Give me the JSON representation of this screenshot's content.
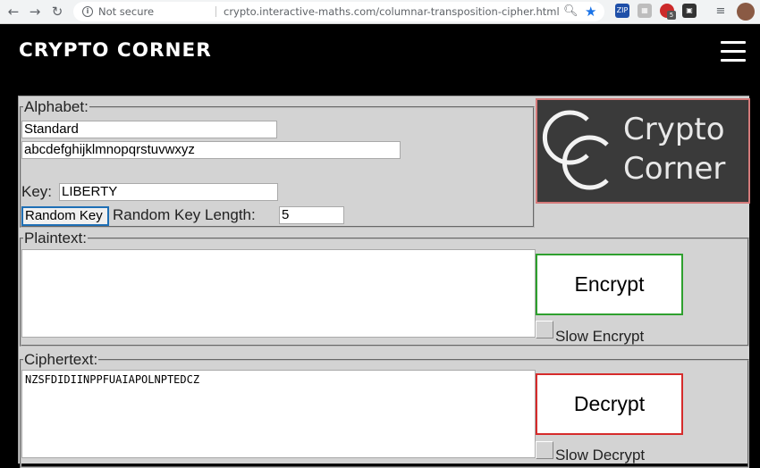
{
  "browser": {
    "security_label": "Not secure",
    "url": "crypto.interactive-maths.com/columnar-transposition-cipher.html",
    "nav_icons": [
      "back-icon",
      "forward-icon",
      "reload-icon"
    ],
    "extension_icons": [
      "extension-zip-icon",
      "extension-puzzle-icon",
      "extension-lastpass-icon",
      "extension-dark-icon"
    ],
    "extension_badge": "5"
  },
  "header": {
    "brand": "CRYPTO CORNER",
    "menu_icon": "hamburger-menu-icon"
  },
  "alphabet": {
    "legend": "Alphabet:",
    "type_value": "Standard",
    "alphabet_value": "abcdefghijklmnopqrstuvwxyz"
  },
  "key": {
    "label": "Key:",
    "value": "LIBERTY",
    "random_key_button": "Random Key",
    "random_length_label": "Random Key Length:",
    "random_length_value": "5"
  },
  "logo": {
    "line1": "Crypto",
    "line2": "Corner"
  },
  "plaintext": {
    "legend": "Plaintext:",
    "value": "",
    "encrypt_button": "Encrypt",
    "slow_label": "Slow Encrypt"
  },
  "ciphertext": {
    "legend": "Ciphertext:",
    "value": "NZSFDIDIINPPFUAIAPOLNPTEDCZ",
    "decrypt_button": "Decrypt",
    "slow_label": "Slow Decrypt"
  },
  "colors": {
    "encrypt_border": "#2ea02e",
    "decrypt_border": "#d62b2b",
    "random_key_border": "#1e6fb5",
    "logo_background": "#3a3a3a",
    "logo_border": "#d47a7a",
    "panel_background": "#d3d3d3"
  }
}
